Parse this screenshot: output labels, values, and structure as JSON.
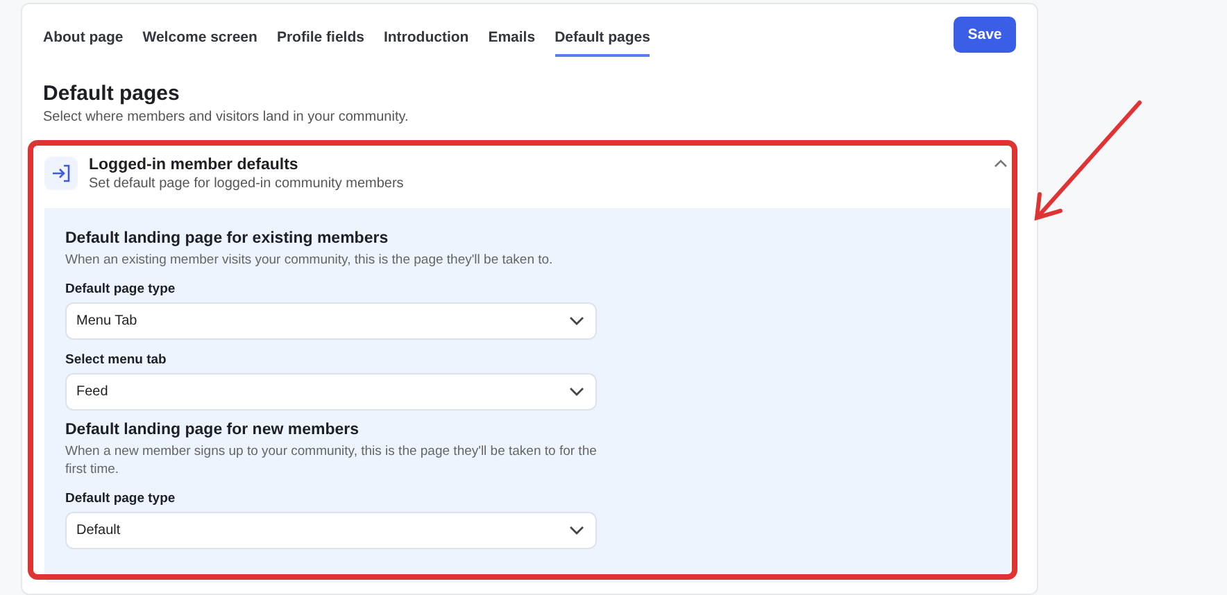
{
  "tabs": [
    {
      "label": "About page",
      "selected": false
    },
    {
      "label": "Welcome screen",
      "selected": false
    },
    {
      "label": "Profile fields",
      "selected": false
    },
    {
      "label": "Introduction",
      "selected": false
    },
    {
      "label": "Emails",
      "selected": false
    },
    {
      "label": "Default pages",
      "selected": true
    }
  ],
  "save_button": "Save",
  "page": {
    "title": "Default pages",
    "subtitle": "Select where members and visitors land in your community."
  },
  "section": {
    "title": "Logged-in member defaults",
    "subtitle": "Set default page for logged-in community members",
    "expanded": true,
    "groups": [
      {
        "title": "Default landing page for existing members",
        "description": "When an existing member visits your community, this is the page they'll be taken to.",
        "fields": [
          {
            "label": "Default page type",
            "value": "Menu Tab"
          },
          {
            "label": "Select menu tab",
            "value": "Feed"
          }
        ]
      },
      {
        "title": "Default landing page for new members",
        "description": "When a new member signs up to your community, this is the page they'll be taken to for the first time.",
        "fields": [
          {
            "label": "Default page type",
            "value": "Default"
          }
        ]
      }
    ]
  }
}
